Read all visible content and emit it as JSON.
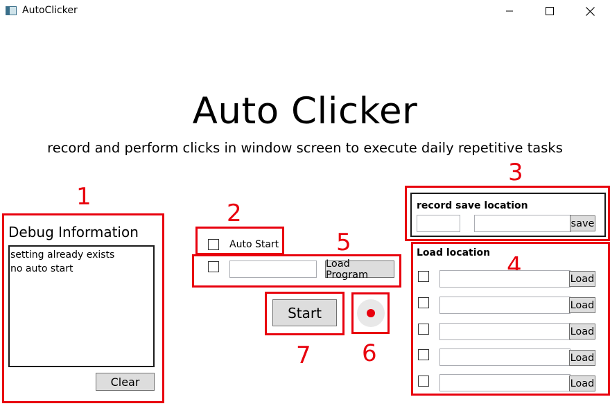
{
  "window": {
    "title": "AutoClicker",
    "controls": [
      "minimize-icon",
      "maximize-icon",
      "close-icon"
    ]
  },
  "header": {
    "title": "Auto Clicker",
    "subtitle": "record and perform clicks in window screen to execute daily repetitive tasks"
  },
  "annotations": {
    "n1": "1",
    "n2": "2",
    "n3": "3",
    "n4": "4",
    "n5": "5",
    "n6": "6",
    "n7": "7",
    "color": "#e8000d"
  },
  "debug": {
    "title": "Debug Information",
    "lines": [
      "setting already exists",
      "no auto start"
    ],
    "clear_label": "Clear"
  },
  "auto_start": {
    "label": "Auto Start",
    "checked": false
  },
  "load_program": {
    "value": "",
    "button_label": "Load Program",
    "checked": false
  },
  "start": {
    "label": "Start"
  },
  "record": {
    "icon": "record-dot-icon",
    "color": "#e8000d"
  },
  "record_save": {
    "title": "record save location",
    "value_small": "",
    "value_large": "",
    "button_label": "save"
  },
  "load_location": {
    "title": "Load location",
    "rows": [
      {
        "checked": false,
        "value": "",
        "button_label": "Load"
      },
      {
        "checked": false,
        "value": "",
        "button_label": "Load"
      },
      {
        "checked": false,
        "value": "",
        "button_label": "Load"
      },
      {
        "checked": false,
        "value": "",
        "button_label": "Load"
      },
      {
        "checked": false,
        "value": "",
        "button_label": "Load"
      }
    ]
  }
}
